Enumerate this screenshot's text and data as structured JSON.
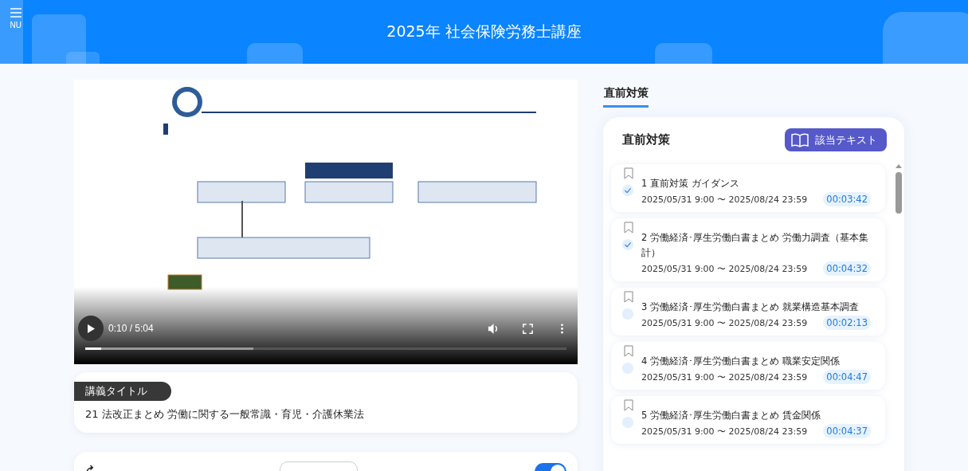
{
  "header": {
    "menu_label": "NU",
    "title": "2025年 社会保険労務士講座"
  },
  "player": {
    "time": "0:10 / 5:04",
    "level": 0.033
  },
  "lecture": {
    "badge": "講義タイトル",
    "title": "21 法改正まとめ 労働に関する一般常識・育児・介護休業法"
  },
  "controls": {
    "autoplay_on": true
  },
  "section_tab": {
    "label": "直前対策",
    "selected": true
  },
  "panel": {
    "title": "直前対策",
    "button": "該当テキスト"
  },
  "lessons": [
    {
      "title": "1 直前対策 ガイダンス",
      "period": "2025/05/31 9:00 〜 2025/08/24 23:59",
      "duration": "00:03:42",
      "completed": true
    },
    {
      "title": "2 労働経済･厚生労働白書まとめ 労働力調査（基本集計）",
      "period": "2025/05/31 9:00 〜 2025/08/24 23:59",
      "duration": "00:04:32",
      "completed": true
    },
    {
      "title": "3 労働経済･厚生労働白書まとめ 就業構造基本調査",
      "period": "2025/05/31 9:00 〜 2025/08/24 23:59",
      "duration": "00:02:13",
      "completed": false
    },
    {
      "title": "4 労働経済･厚生労働白書まとめ 職業安定関係",
      "period": "2025/05/31 9:00 〜 2025/08/24 23:59",
      "duration": "00:04:47",
      "completed": false
    },
    {
      "title": "5 労働経済･厚生労働白書まとめ 賃金関係",
      "period": "2025/05/31 9:00 〜 2025/08/24 23:59",
      "duration": "00:04:37",
      "completed": false
    }
  ]
}
